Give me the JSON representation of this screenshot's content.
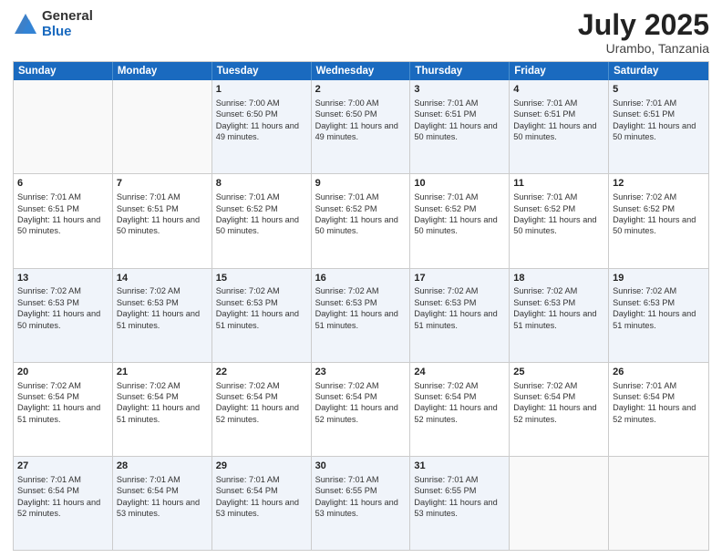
{
  "logo": {
    "general": "General",
    "blue": "Blue"
  },
  "title": {
    "month_year": "July 2025",
    "location": "Urambo, Tanzania"
  },
  "header_days": [
    "Sunday",
    "Monday",
    "Tuesday",
    "Wednesday",
    "Thursday",
    "Friday",
    "Saturday"
  ],
  "weeks": [
    [
      {
        "day": "",
        "info": "",
        "empty": true
      },
      {
        "day": "",
        "info": "",
        "empty": true
      },
      {
        "day": "1",
        "info": "Sunrise: 7:00 AM\nSunset: 6:50 PM\nDaylight: 11 hours and 49 minutes.",
        "empty": false
      },
      {
        "day": "2",
        "info": "Sunrise: 7:00 AM\nSunset: 6:50 PM\nDaylight: 11 hours and 49 minutes.",
        "empty": false
      },
      {
        "day": "3",
        "info": "Sunrise: 7:01 AM\nSunset: 6:51 PM\nDaylight: 11 hours and 50 minutes.",
        "empty": false
      },
      {
        "day": "4",
        "info": "Sunrise: 7:01 AM\nSunset: 6:51 PM\nDaylight: 11 hours and 50 minutes.",
        "empty": false
      },
      {
        "day": "5",
        "info": "Sunrise: 7:01 AM\nSunset: 6:51 PM\nDaylight: 11 hours and 50 minutes.",
        "empty": false
      }
    ],
    [
      {
        "day": "6",
        "info": "Sunrise: 7:01 AM\nSunset: 6:51 PM\nDaylight: 11 hours and 50 minutes.",
        "empty": false
      },
      {
        "day": "7",
        "info": "Sunrise: 7:01 AM\nSunset: 6:51 PM\nDaylight: 11 hours and 50 minutes.",
        "empty": false
      },
      {
        "day": "8",
        "info": "Sunrise: 7:01 AM\nSunset: 6:52 PM\nDaylight: 11 hours and 50 minutes.",
        "empty": false
      },
      {
        "day": "9",
        "info": "Sunrise: 7:01 AM\nSunset: 6:52 PM\nDaylight: 11 hours and 50 minutes.",
        "empty": false
      },
      {
        "day": "10",
        "info": "Sunrise: 7:01 AM\nSunset: 6:52 PM\nDaylight: 11 hours and 50 minutes.",
        "empty": false
      },
      {
        "day": "11",
        "info": "Sunrise: 7:01 AM\nSunset: 6:52 PM\nDaylight: 11 hours and 50 minutes.",
        "empty": false
      },
      {
        "day": "12",
        "info": "Sunrise: 7:02 AM\nSunset: 6:52 PM\nDaylight: 11 hours and 50 minutes.",
        "empty": false
      }
    ],
    [
      {
        "day": "13",
        "info": "Sunrise: 7:02 AM\nSunset: 6:53 PM\nDaylight: 11 hours and 50 minutes.",
        "empty": false
      },
      {
        "day": "14",
        "info": "Sunrise: 7:02 AM\nSunset: 6:53 PM\nDaylight: 11 hours and 51 minutes.",
        "empty": false
      },
      {
        "day": "15",
        "info": "Sunrise: 7:02 AM\nSunset: 6:53 PM\nDaylight: 11 hours and 51 minutes.",
        "empty": false
      },
      {
        "day": "16",
        "info": "Sunrise: 7:02 AM\nSunset: 6:53 PM\nDaylight: 11 hours and 51 minutes.",
        "empty": false
      },
      {
        "day": "17",
        "info": "Sunrise: 7:02 AM\nSunset: 6:53 PM\nDaylight: 11 hours and 51 minutes.",
        "empty": false
      },
      {
        "day": "18",
        "info": "Sunrise: 7:02 AM\nSunset: 6:53 PM\nDaylight: 11 hours and 51 minutes.",
        "empty": false
      },
      {
        "day": "19",
        "info": "Sunrise: 7:02 AM\nSunset: 6:53 PM\nDaylight: 11 hours and 51 minutes.",
        "empty": false
      }
    ],
    [
      {
        "day": "20",
        "info": "Sunrise: 7:02 AM\nSunset: 6:54 PM\nDaylight: 11 hours and 51 minutes.",
        "empty": false
      },
      {
        "day": "21",
        "info": "Sunrise: 7:02 AM\nSunset: 6:54 PM\nDaylight: 11 hours and 51 minutes.",
        "empty": false
      },
      {
        "day": "22",
        "info": "Sunrise: 7:02 AM\nSunset: 6:54 PM\nDaylight: 11 hours and 52 minutes.",
        "empty": false
      },
      {
        "day": "23",
        "info": "Sunrise: 7:02 AM\nSunset: 6:54 PM\nDaylight: 11 hours and 52 minutes.",
        "empty": false
      },
      {
        "day": "24",
        "info": "Sunrise: 7:02 AM\nSunset: 6:54 PM\nDaylight: 11 hours and 52 minutes.",
        "empty": false
      },
      {
        "day": "25",
        "info": "Sunrise: 7:02 AM\nSunset: 6:54 PM\nDaylight: 11 hours and 52 minutes.",
        "empty": false
      },
      {
        "day": "26",
        "info": "Sunrise: 7:01 AM\nSunset: 6:54 PM\nDaylight: 11 hours and 52 minutes.",
        "empty": false
      }
    ],
    [
      {
        "day": "27",
        "info": "Sunrise: 7:01 AM\nSunset: 6:54 PM\nDaylight: 11 hours and 52 minutes.",
        "empty": false
      },
      {
        "day": "28",
        "info": "Sunrise: 7:01 AM\nSunset: 6:54 PM\nDaylight: 11 hours and 53 minutes.",
        "empty": false
      },
      {
        "day": "29",
        "info": "Sunrise: 7:01 AM\nSunset: 6:54 PM\nDaylight: 11 hours and 53 minutes.",
        "empty": false
      },
      {
        "day": "30",
        "info": "Sunrise: 7:01 AM\nSunset: 6:55 PM\nDaylight: 11 hours and 53 minutes.",
        "empty": false
      },
      {
        "day": "31",
        "info": "Sunrise: 7:01 AM\nSunset: 6:55 PM\nDaylight: 11 hours and 53 minutes.",
        "empty": false
      },
      {
        "day": "",
        "info": "",
        "empty": true
      },
      {
        "day": "",
        "info": "",
        "empty": true
      }
    ]
  ],
  "alt_rows": [
    0,
    2,
    4
  ]
}
